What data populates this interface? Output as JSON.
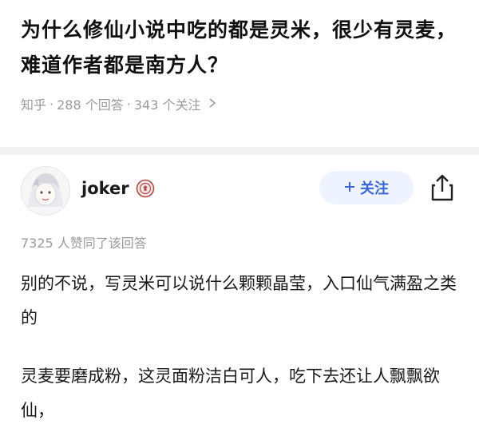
{
  "question": {
    "title": "为什么修仙小说中吃的都是灵米，很少有灵麦，难道作者都是南方人？",
    "source": "知乎",
    "sep1": "·",
    "answers": "288 个回答",
    "sep2": "·",
    "followers": "343 个关注"
  },
  "answer": {
    "author": "joker",
    "follow_label": "关注",
    "likes_text": "7325 人赞同了该回答",
    "paragraphs": [
      "别的不说，写灵米可以说什么颗颗晶莹，入口仙气满盈之类的",
      "灵麦要磨成粉，这灵面粉洁白可人，吃下去还让人飘飘欲仙，"
    ]
  },
  "colors": {
    "accent": "#3a66d6",
    "follow_bg": "#eef3ff",
    "meta_text": "#9a9a9a",
    "divider": "#f2f2f2"
  },
  "icons": {
    "meta": "chevron-right-icon",
    "badge": "certified-badge-icon",
    "follow": "plus-icon",
    "share": "share-icon"
  }
}
